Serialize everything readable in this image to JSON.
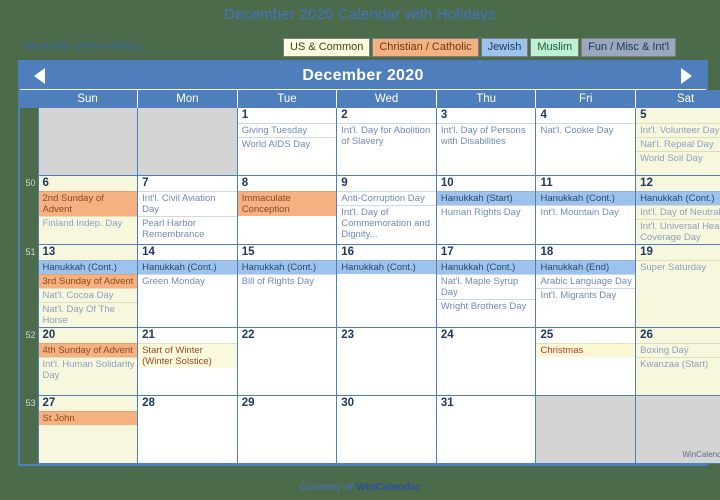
{
  "title": "December 2020 Calendar with Holidays",
  "legend": {
    "label": "December 2020 Holidays:",
    "chips": [
      {
        "label": "US & Common",
        "key": "us"
      },
      {
        "label": "Christian / Catholic",
        "key": "chr"
      },
      {
        "label": "Jewish",
        "key": "jew"
      },
      {
        "label": "Muslim",
        "key": "mus"
      },
      {
        "label": "Fun / Misc & Int'l",
        "key": "fun"
      }
    ]
  },
  "calendar": {
    "month_title": "December 2020",
    "prev_icon": "left-triangle-icon",
    "next_icon": "right-triangle-icon",
    "weekday_headers": [
      "Sun",
      "Mon",
      "Tue",
      "Wed",
      "Thu",
      "Fri",
      "Sat"
    ],
    "week_numbers": [
      "",
      "50",
      "51",
      "52",
      "53"
    ],
    "weeks": [
      {
        "number": "",
        "days": [
          {
            "num": "",
            "blank": true,
            "events": []
          },
          {
            "num": "",
            "blank": true,
            "events": []
          },
          {
            "num": "1",
            "events": [
              {
                "text": "Giving Tuesday",
                "style": "plain"
              },
              {
                "text": "World AIDS Day",
                "style": "plain"
              }
            ]
          },
          {
            "num": "2",
            "events": [
              {
                "text": "Int'l. Day for Abolition of Slavery",
                "style": "plain"
              }
            ]
          },
          {
            "num": "3",
            "events": [
              {
                "text": "Int'l. Day of Persons with Disabilities",
                "style": "plain"
              }
            ]
          },
          {
            "num": "4",
            "events": [
              {
                "text": "Nat'l. Cookie Day",
                "style": "plain"
              }
            ]
          },
          {
            "num": "5",
            "cream": true,
            "events": [
              {
                "text": "Int'l. Volunteer Day",
                "style": "oncream"
              },
              {
                "text": "Nat'l. Repeal Day",
                "style": "oncream"
              },
              {
                "text": "World Soil Day",
                "style": "oncream"
              }
            ]
          }
        ]
      },
      {
        "number": "50",
        "days": [
          {
            "num": "6",
            "cream": true,
            "events": [
              {
                "text": "2nd Sunday of Advent",
                "style": "christian"
              },
              {
                "text": "Finland Indep. Day",
                "style": "oncream"
              }
            ]
          },
          {
            "num": "7",
            "events": [
              {
                "text": "Int'l. Civil Aviation Day",
                "style": "plain"
              },
              {
                "text": "Pearl Harbor Remembrance",
                "style": "plain"
              }
            ]
          },
          {
            "num": "8",
            "events": [
              {
                "text": "Immaculate Conception",
                "style": "christian"
              }
            ]
          },
          {
            "num": "9",
            "events": [
              {
                "text": "Anti-Corruption Day",
                "style": "plain"
              },
              {
                "text": "Int'l. Day of Commemoration and Dignity...",
                "style": "plain"
              }
            ]
          },
          {
            "num": "10",
            "events": [
              {
                "text": "Hanukkah (Start)",
                "style": "jewish"
              },
              {
                "text": "Human Rights Day",
                "style": "plain"
              }
            ]
          },
          {
            "num": "11",
            "events": [
              {
                "text": "Hanukkah (Cont.)",
                "style": "jewish"
              },
              {
                "text": "Int'l. Mountain Day",
                "style": "plain"
              }
            ]
          },
          {
            "num": "12",
            "cream": true,
            "events": [
              {
                "text": "Hanukkah (Cont.)",
                "style": "jewish"
              },
              {
                "text": "Int'l. Day of Neutrality",
                "style": "oncream"
              },
              {
                "text": "Int'l. Universal Health Coverage Day",
                "style": "oncream"
              }
            ]
          }
        ]
      },
      {
        "number": "51",
        "days": [
          {
            "num": "13",
            "cream": true,
            "events": [
              {
                "text": "Hanukkah (Cont.)",
                "style": "jewish"
              },
              {
                "text": "3rd Sunday of Advent",
                "style": "christian"
              },
              {
                "text": "Nat'l. Cocoa Day",
                "style": "oncream"
              },
              {
                "text": "Nat'l. Day Of The Horse",
                "style": "oncream"
              }
            ]
          },
          {
            "num": "14",
            "events": [
              {
                "text": "Hanukkah (Cont.)",
                "style": "jewish"
              },
              {
                "text": "Green Monday",
                "style": "plain"
              }
            ]
          },
          {
            "num": "15",
            "events": [
              {
                "text": "Hanukkah (Cont.)",
                "style": "jewish"
              },
              {
                "text": "Bill of Rights Day",
                "style": "plain"
              }
            ]
          },
          {
            "num": "16",
            "events": [
              {
                "text": "Hanukkah (Cont.)",
                "style": "jewish"
              }
            ]
          },
          {
            "num": "17",
            "events": [
              {
                "text": "Hanukkah (Cont.)",
                "style": "jewish"
              },
              {
                "text": "Nat'l. Maple Syrup Day",
                "style": "plain"
              },
              {
                "text": "Wright Brothers Day",
                "style": "plain"
              }
            ]
          },
          {
            "num": "18",
            "events": [
              {
                "text": "Hanukkah (End)",
                "style": "jewish"
              },
              {
                "text": "Arabic Language Day",
                "style": "plain"
              },
              {
                "text": "Int'l. Migrants Day",
                "style": "plain"
              }
            ]
          },
          {
            "num": "19",
            "cream": true,
            "events": [
              {
                "text": "Super Saturday",
                "style": "oncream"
              }
            ]
          }
        ]
      },
      {
        "number": "52",
        "days": [
          {
            "num": "20",
            "cream": true,
            "events": [
              {
                "text": "4th Sunday of Advent",
                "style": "christian"
              },
              {
                "text": "Int'l. Human Solidarity Day",
                "style": "oncream"
              }
            ]
          },
          {
            "num": "21",
            "events": [
              {
                "text": "Start of Winter (Winter Solstice)",
                "style": "us"
              }
            ]
          },
          {
            "num": "22",
            "events": []
          },
          {
            "num": "23",
            "events": []
          },
          {
            "num": "24",
            "events": []
          },
          {
            "num": "25",
            "events": [
              {
                "text": "Christmas",
                "style": "xmas"
              }
            ]
          },
          {
            "num": "26",
            "cream": true,
            "events": [
              {
                "text": "Boxing Day",
                "style": "oncream"
              },
              {
                "text": "Kwanzaa (Start)",
                "style": "oncream"
              }
            ]
          }
        ]
      },
      {
        "number": "53",
        "days": [
          {
            "num": "27",
            "cream": true,
            "events": [
              {
                "text": "St John",
                "style": "christian"
              }
            ]
          },
          {
            "num": "28",
            "events": []
          },
          {
            "num": "29",
            "events": []
          },
          {
            "num": "30",
            "events": []
          },
          {
            "num": "31",
            "events": []
          },
          {
            "num": "",
            "blank": true,
            "events": []
          },
          {
            "num": "",
            "gray": true,
            "watermark": "WinCalendar",
            "events": []
          }
        ]
      }
    ]
  },
  "footer": {
    "prefix": "Courtesy of ",
    "brand": "WinCalendar"
  }
}
